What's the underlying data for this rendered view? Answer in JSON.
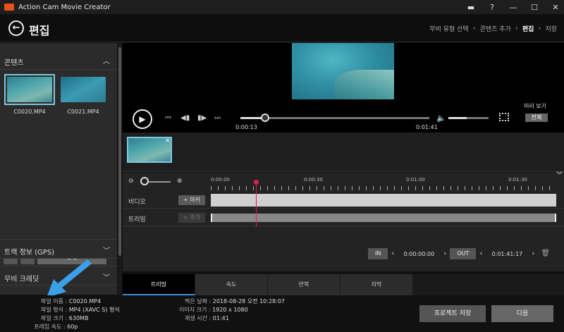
{
  "app": {
    "title": "Action Cam Movie Creator"
  },
  "header": {
    "title": "편집",
    "breadcrumb": [
      "무비 유형 선택",
      "콘텐츠 추가",
      "편집",
      "저장"
    ]
  },
  "left_panel": {
    "contents_label": "콘텐츠",
    "clips": [
      {
        "name": "C0020.MP4",
        "selected": true
      },
      {
        "name": "C0021.MP4",
        "selected": false
      }
    ],
    "flip_label": "반전",
    "track_info_label": "트랙 정보 (GPS)",
    "movie_credit_label": "무비 크레딧"
  },
  "preview": {
    "current_time": "0:00:13",
    "total_time": "0:01:41",
    "progress": 0.13,
    "volume": 0.45,
    "preview_label": "미리 보기",
    "full_label": "전체"
  },
  "timeline": {
    "ticks": [
      "0:00:00",
      "0:00:30",
      "0:01:00",
      "0:01:30"
    ],
    "video_label": "비디오",
    "trim_label": "트리밍",
    "marker_label": "+ 마커",
    "add_label": "+ 추가",
    "in_label": "IN",
    "in_time": "0:00:00:00",
    "out_label": "OUT",
    "out_time": "0:01:41:17"
  },
  "tabs": [
    "트리밍",
    "속도",
    "반복",
    "자막"
  ],
  "info": {
    "file_name_label": "파일 이름 :",
    "file_name": "C0020.MP4",
    "file_format_label": "파일 형식 :",
    "file_format": "MP4 (XAVC S) 형식",
    "file_size_label": "파일 크기 :",
    "file_size": "630MB",
    "frame_rate_label": "프레임 속도 :",
    "frame_rate": "60p",
    "shot_date_label": "찍은 날짜 :",
    "shot_date": "2018-08-28 오전 10:28:07",
    "image_size_label": "이미지 크기 :",
    "image_size": "1920 x 1080",
    "play_time_label": "재생 시간 :",
    "play_time": "01:41"
  },
  "buttons": {
    "save_project": "프로젝트 저장",
    "next": "다음"
  },
  "colors": {
    "accent": "#7ec8e3",
    "playhead": "#e0204a",
    "tab_active": "#3b8fd6",
    "annotation_arrow": "#3aa0e8"
  }
}
